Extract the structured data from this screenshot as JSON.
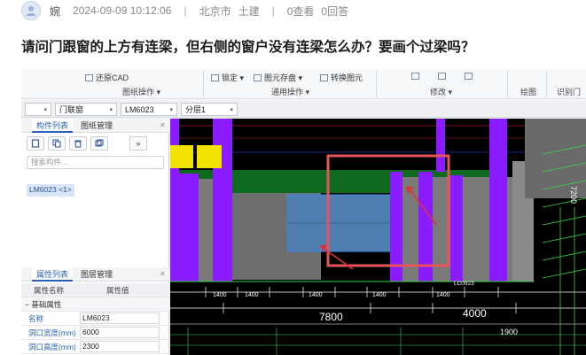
{
  "post": {
    "user": "婉",
    "time": "2024-09-09 10:12:06",
    "sep1": "|",
    "location": "北京市",
    "category": "土建",
    "sep2": "|",
    "views": "0查看",
    "answers": "0回答"
  },
  "question": "请问门跟窗的上方有连梁，但右侧的窗户没有连梁怎么办？要画个过梁吗？",
  "screenshot": {
    "ribbon": {
      "restore_cad": "还原CAD",
      "drawing_ops": "图纸操作",
      "lock": "锁定",
      "element_store": "图元存盘",
      "convert_element": "转换图元",
      "general_ops": "通用操作",
      "modify": "修改",
      "draw": "绘图",
      "recognize_door": "识别门",
      "dropdown_caret": "▾"
    },
    "toolbar": {
      "first_select": "",
      "category_select": "门联窗",
      "element_select": "LM6023",
      "floor_select": "分层1",
      "caret": "▾"
    },
    "left_panel": {
      "tab_components": "构件列表",
      "tab_drawings": "图纸管理",
      "close": "×",
      "more": "»",
      "search_placeholder": "搜索构件...",
      "selected_component": "LM6023 <1>"
    },
    "properties": {
      "tab_properties": "属性列表",
      "tab_layers": "图层管理",
      "close": "×",
      "col_name": "属性名称",
      "col_value": "属性值",
      "group": "基础属性",
      "rows": [
        {
          "name": "名称",
          "value": "LM6023"
        },
        {
          "name": "洞口宽度(mm)",
          "value": "6000"
        },
        {
          "name": "洞口高度(mm)",
          "value": "2300"
        }
      ]
    },
    "cad": {
      "dim_7800": "7800",
      "dim_4000": "4000",
      "dim_1900": "1900",
      "dims_small": [
        "1400",
        "1400",
        "1400",
        "1400",
        "1400"
      ],
      "label_lc0923": "LC0923",
      "label_7200": "7200",
      "annotation_colors": {
        "highlight_box": "#e8545c",
        "arrow": "#e03030",
        "wall": "#7a7a7a",
        "column": "#8a1cff",
        "beam": "#0f6b1f",
        "window": "#3c86e0",
        "yellow_block": "#f2e200"
      }
    }
  }
}
